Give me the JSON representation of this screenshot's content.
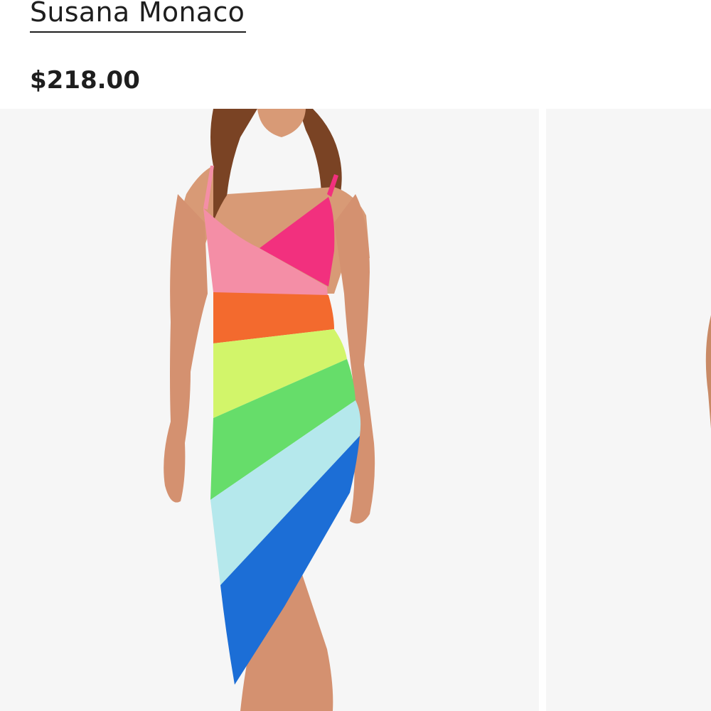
{
  "product": {
    "brand": "Susana Monaco",
    "price": "$218.00"
  },
  "gallery": {
    "images": [
      {
        "alt": "Rainbow stripe asymmetric dress"
      },
      {
        "alt": ""
      }
    ],
    "dress_stripe_colors": [
      "#f48ea6",
      "#f2307e",
      "#f36a2e",
      "#d2f56a",
      "#66dd6a",
      "#b5e8ec",
      "#1c6ed6"
    ],
    "background_color": "#f6f6f6"
  }
}
